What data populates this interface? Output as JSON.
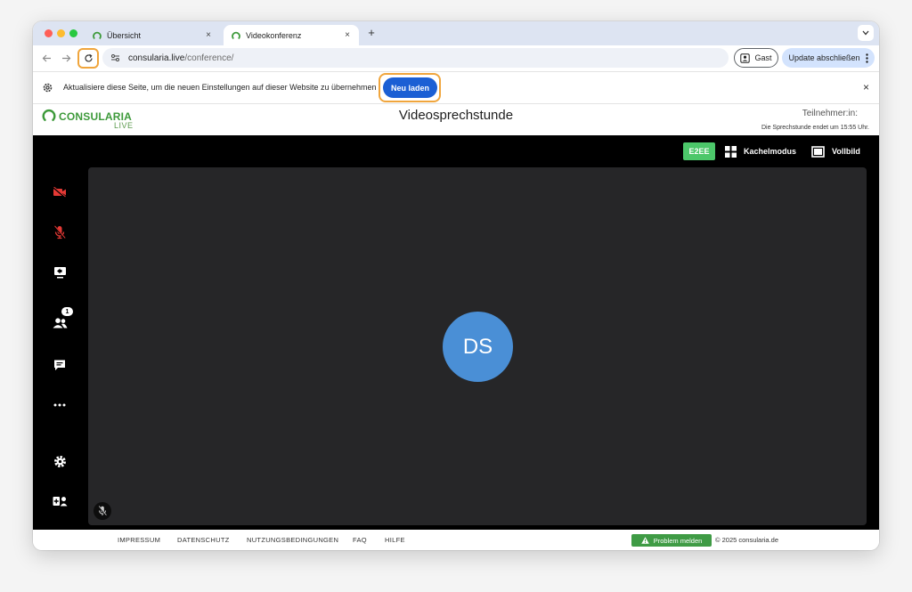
{
  "browser": {
    "tabs": [
      {
        "title": "Übersicht",
        "active": false
      },
      {
        "title": "Videokonferenz",
        "active": true
      }
    ],
    "new_tab_symbol": "+",
    "tab_close_symbol": "×",
    "address": {
      "host": "consularia.live",
      "path": "/conference/"
    },
    "profile_label": "Gast",
    "update_label": "Update abschließen",
    "infobar": {
      "message": "Aktualisiere diese Seite, um die neuen Einstellungen auf dieser Website zu übernehmen",
      "reload_label": "Neu laden",
      "close_symbol": "×"
    }
  },
  "header": {
    "logo_text": "CONSULARIA",
    "logo_sub": "LIVE",
    "title": "Videosprechstunde",
    "participants_label": "Teilnehmer:in:",
    "session_end": "Die Sprechstunde endet um 15:55 Uhr."
  },
  "conference": {
    "e2ee_label": "E2EE",
    "tile_mode_label": "Kachelmodus",
    "fullscreen_label": "Vollbild",
    "participants_badge": "1",
    "avatar_initials": "DS",
    "sidebar_icons": [
      "camera-off-icon",
      "mic-off-icon",
      "screen-share-icon",
      "participants-icon",
      "chat-icon",
      "more-icon",
      "settings-icon",
      "add-person-icon"
    ]
  },
  "footer": {
    "links": [
      "IMPRESSUM",
      "DATENSCHUTZ",
      "NUTZUNGSBEDINGUNGEN",
      "FAQ",
      "HILFE"
    ],
    "problem_label": "Problem melden",
    "copyright": "© 2025 consularia.de"
  },
  "colors": {
    "brand_green": "#3d9a3a",
    "e2ee_green": "#4cc76a",
    "reload_blue": "#1b5fd4",
    "highlight_orange": "#f0a53c",
    "muted_red": "#e53935",
    "avatar_blue": "#4a8fd6"
  }
}
